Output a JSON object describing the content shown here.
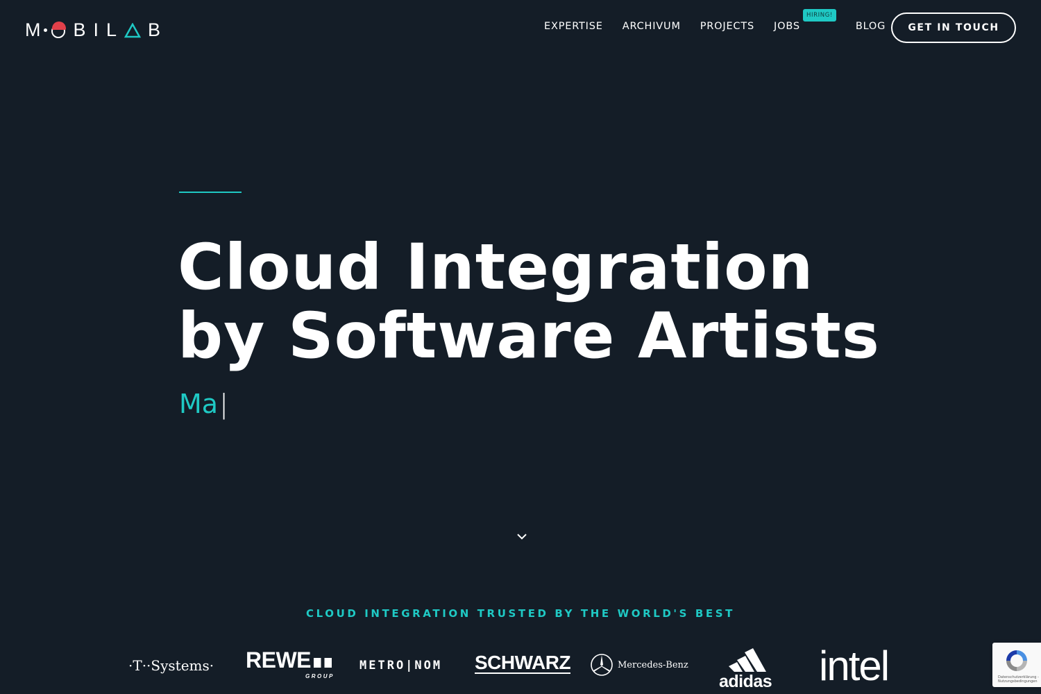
{
  "brand": {
    "logo_text": "MOBILAB",
    "accent_color": "#1fc9c4",
    "background_color": "#141d27",
    "hat_color": "#e2404a"
  },
  "nav": {
    "items": [
      {
        "label": "EXPERTISE"
      },
      {
        "label": "ARCHIVUM"
      },
      {
        "label": "PROJECTS"
      },
      {
        "label": "JOBS",
        "badge": "HIRING!"
      },
      {
        "label": "BLOG"
      }
    ],
    "cta_label": "GET IN TOUCH"
  },
  "hero": {
    "title_line1": "Cloud Integration",
    "title_line2": "by Software Artists",
    "typed_text": "Ma",
    "cursor": "|"
  },
  "scroll_icon": "chevron-down-icon",
  "trusted": {
    "heading": "CLOUD INTEGRATION TRUSTED BY THE WORLD'S BEST",
    "clients": [
      {
        "name": "·T··Systems·"
      },
      {
        "name": "REWE",
        "sub": "GROUP"
      },
      {
        "name": "METRO|NOM"
      },
      {
        "name": "SCHWARZ"
      },
      {
        "name": "Mercedes-Benz"
      },
      {
        "name": "adidas"
      },
      {
        "name": "intel"
      }
    ]
  },
  "recaptcha": {
    "terms_line1": "Datenschutzerklärung -",
    "terms_line2": "Nutzungsbedingungen"
  }
}
